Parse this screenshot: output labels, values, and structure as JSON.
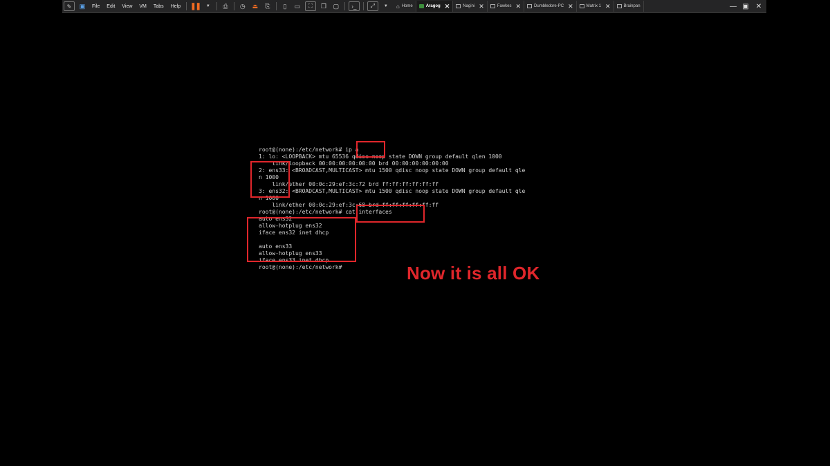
{
  "menu": [
    "File",
    "Edit",
    "View",
    "VM",
    "Tabs",
    "Help"
  ],
  "tabs": [
    {
      "label": "Home",
      "active": false,
      "closable": false,
      "icon": "home-icon"
    },
    {
      "label": "Aragog",
      "active": true,
      "closable": true,
      "icon": "vm-icon"
    },
    {
      "label": "Nagini",
      "active": false,
      "closable": true,
      "icon": "vm-icon"
    },
    {
      "label": "Fawkes",
      "active": false,
      "closable": true,
      "icon": "vm-icon"
    },
    {
      "label": "Dumbledore-PC",
      "active": false,
      "closable": true,
      "icon": "vm-icon"
    },
    {
      "label": "Matrix 1",
      "active": false,
      "closable": true,
      "icon": "vm-icon"
    },
    {
      "label": "Brainpan",
      "active": false,
      "closable": false,
      "icon": "vm-icon"
    }
  ],
  "colors": {
    "accent_red": "#e0262b",
    "toolbar_bg": "#252526",
    "pause_orange": "#f26b21",
    "terminal_text": "#d4d4d4"
  },
  "terminal": {
    "lines": [
      "root@(none):/etc/network# ip a",
      "1: lo: <LOOPBACK> mtu 65536 qdisc noop state DOWN group default qlen 1000",
      "    link/loopback 00:00:00:00:00:00 brd 00:00:00:00:00:00",
      "2: ens33: <BROADCAST,MULTICAST> mtu 1500 qdisc noop state DOWN group default qle",
      "n 1000",
      "    link/ether 00:0c:29:ef:3c:72 brd ff:ff:ff:ff:ff:ff",
      "3: ens32: <BROADCAST,MULTICAST> mtu 1500 qdisc noop state DOWN group default qle",
      "n 1000",
      "    link/ether 00:0c:29:ef:3c:68 brd ff:ff:ff:ff:ff:ff",
      "root@(none):/etc/network# cat interfaces",
      "auto ens32",
      "allow-hotplug ens32",
      "iface ens32 inet dhcp",
      "",
      "auto ens33",
      "allow-hotplug ens33",
      "iface ens33 inet dhcp",
      "root@(none):/etc/network#"
    ]
  },
  "caption": "Now it is all OK"
}
